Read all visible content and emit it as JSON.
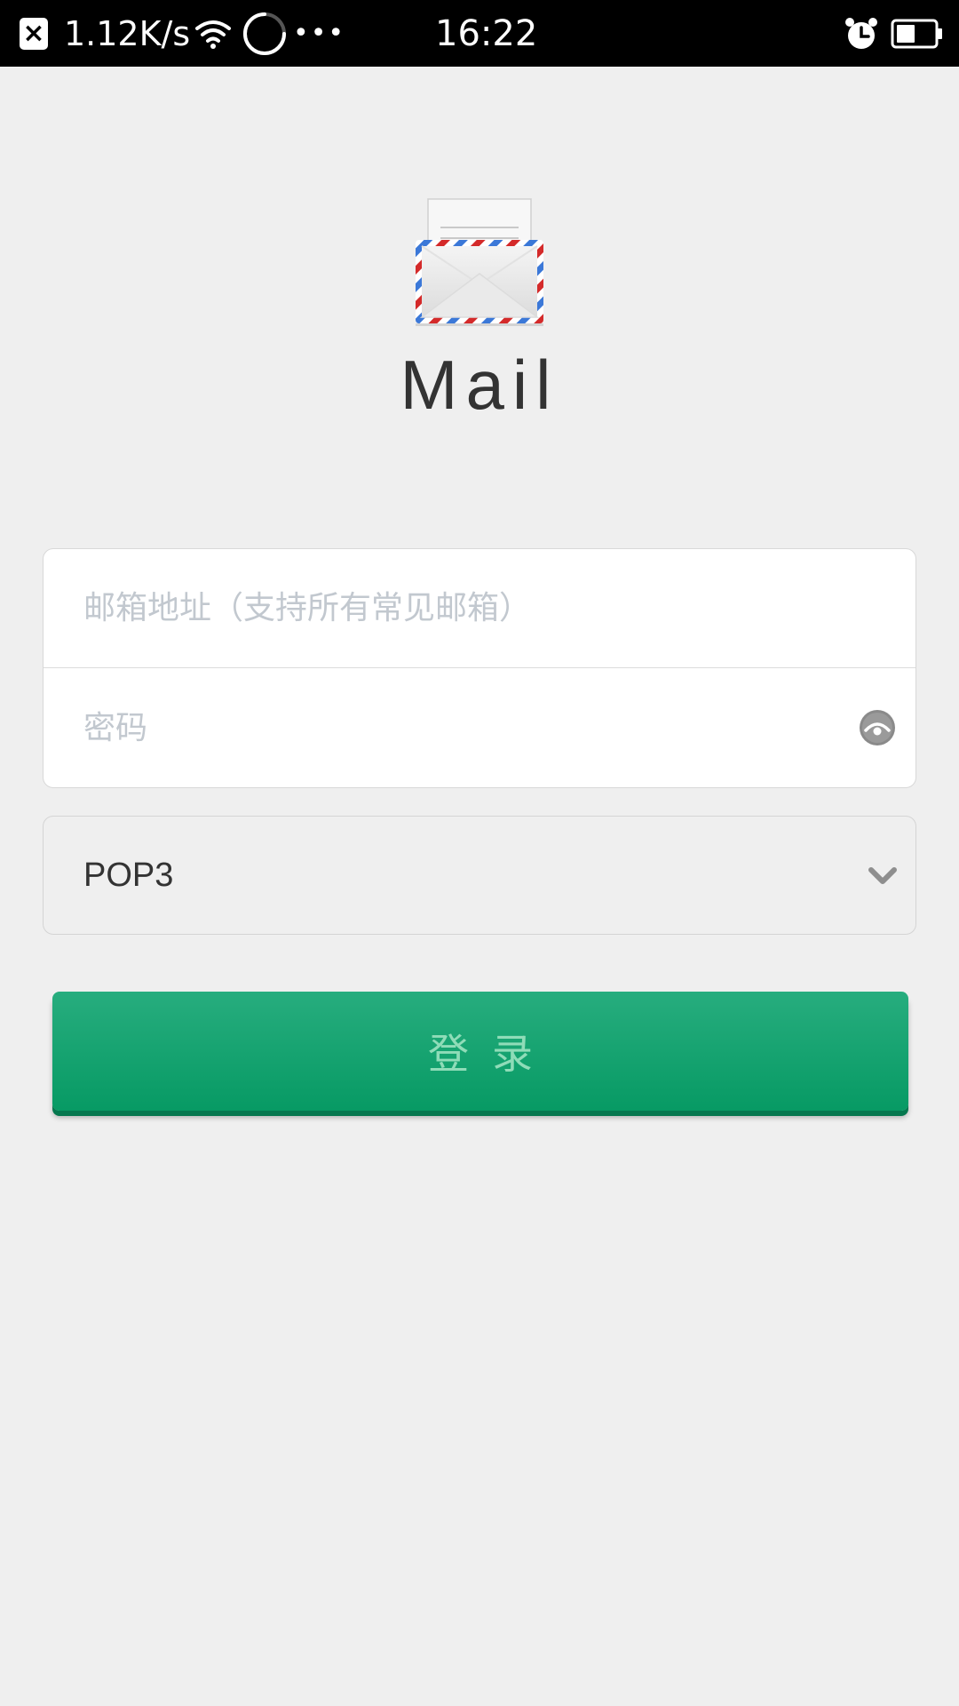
{
  "status_bar": {
    "close_symbol": "×",
    "net_speed": "1.12K/s",
    "dots": "•••",
    "time": "16:22",
    "icons": [
      "close-notification-icon",
      "wifi-icon",
      "loading-spinner-icon",
      "alarm-icon",
      "battery-icon"
    ]
  },
  "app": {
    "title": "Mail",
    "logo": "mail-envelope-icon"
  },
  "form": {
    "email_placeholder": "邮箱地址（支持所有常见邮箱）",
    "email_value": "",
    "password_placeholder": "密码",
    "password_value": "",
    "password_toggle_icon": "eye-icon"
  },
  "protocol": {
    "selected": "POP3",
    "dropdown_icon": "chevron-down-icon"
  },
  "login": {
    "label": "登录"
  },
  "colors": {
    "background": "#efefef",
    "accent": "#14a370",
    "placeholder": "#c2c8cf"
  }
}
